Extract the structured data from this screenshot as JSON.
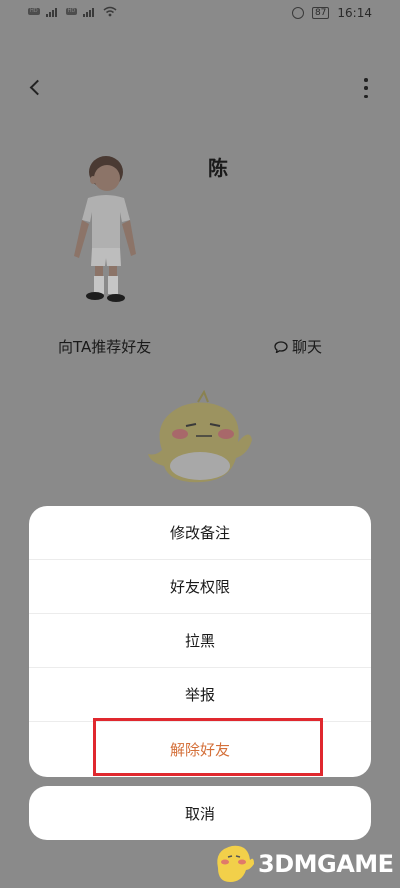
{
  "status_bar": {
    "chip_labels": [
      "HD",
      "4G",
      "HD",
      "4G"
    ],
    "battery": "87",
    "time": "16:14"
  },
  "header": {
    "back_icon": "chevron-left-icon",
    "more_icon": "more-vertical-icon"
  },
  "profile": {
    "name": "陈",
    "recommend_label": "向TA推荐好友",
    "chat_label": "聊天",
    "chat_icon": "chat-bubble-icon"
  },
  "action_sheet": {
    "items": [
      {
        "label": "修改备注"
      },
      {
        "label": "好友权限"
      },
      {
        "label": "拉黑"
      },
      {
        "label": "举报"
      },
      {
        "label": "解除好友"
      }
    ],
    "highlight_color": "#e0282e",
    "danger_color": "#d4703a",
    "cancel_label": "取消"
  },
  "watermark": {
    "text": "3DMGAME"
  }
}
